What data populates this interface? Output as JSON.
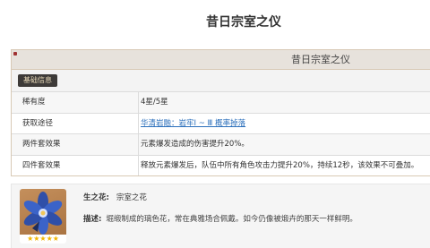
{
  "page": {
    "title": "昔日宗室之仪"
  },
  "infobox": {
    "header_title": "昔日宗室之仪",
    "tab_label": "基础信息",
    "rows": [
      {
        "label": "稀有度",
        "value": "4星/5星",
        "is_link": false
      },
      {
        "label": "获取途径",
        "value": "华清岩融：岩牢Ⅰ ~ Ⅲ 概率掉落",
        "is_link": true
      },
      {
        "label": "两件套效果",
        "value": "元素爆发造成的伤害提升20%。",
        "is_link": false
      },
      {
        "label": "四件套效果",
        "value": "释放元素爆发后，队伍中所有角色攻击力提升20%，持续12秒，该效果不可叠加。",
        "is_link": false
      }
    ]
  },
  "piece": {
    "slot_label": "生之花:",
    "name": "宗室之花",
    "desc_label": "描述:",
    "description": "堀缎制成的璃色花，常在典雅场合佩戴。如今仍像被煅卉的那天一样鲜明。",
    "stars": "★★★★★",
    "icon": "blue-flower-icon"
  },
  "colors": {
    "link": "#2b6fbb",
    "star": "#f2b500",
    "chip_bg": "#3d3a38",
    "chip_text": "#e8d9b8",
    "accent_border": "#d8c9b5"
  }
}
